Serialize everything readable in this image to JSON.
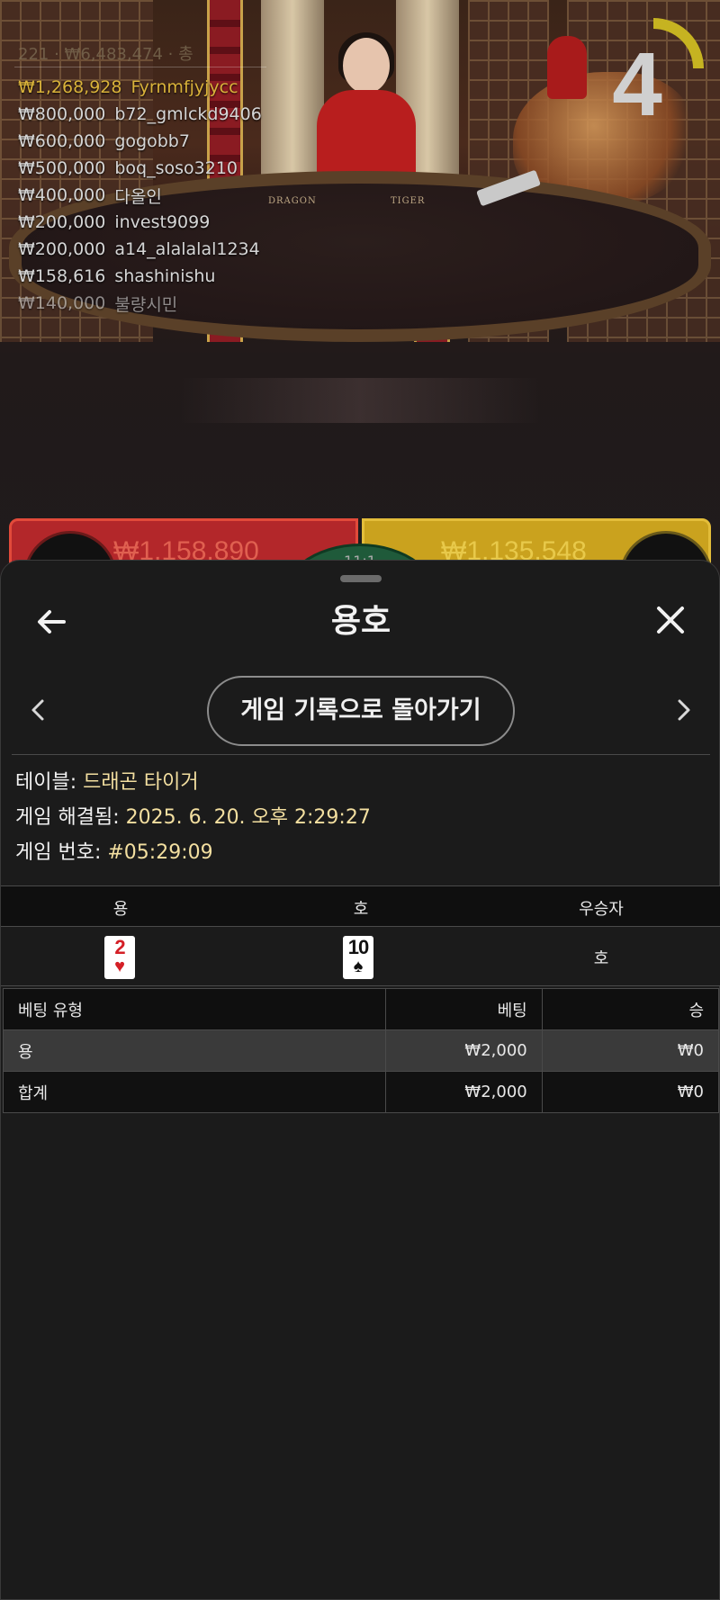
{
  "video": {
    "stats": "221 · ₩6,483,474 · 총",
    "table_labels": {
      "dragon": "DRAGON",
      "tiger": "TIGER"
    },
    "timer": "4",
    "leaderboard": [
      {
        "amount": "₩1,268,928",
        "name": "Fyrnmfjyjycc"
      },
      {
        "amount": "₩800,000",
        "name": "b72_gmlckd9406"
      },
      {
        "amount": "₩600,000",
        "name": "gogobb7"
      },
      {
        "amount": "₩500,000",
        "name": "boq_soso3210"
      },
      {
        "amount": "₩400,000",
        "name": "다올인"
      },
      {
        "amount": "₩200,000",
        "name": "invest9099"
      },
      {
        "amount": "₩200,000",
        "name": "a14_alalalal1234"
      },
      {
        "amount": "₩158,616",
        "name": "shashinishu"
      },
      {
        "amount": "₩140,000",
        "name": "불량시민"
      }
    ],
    "bets": {
      "dragon_total": "₩1,158,890",
      "tiger_total": "₩1,135,548",
      "tie_label": "11:1"
    }
  },
  "sheet": {
    "title": "용호",
    "back_to_history": "게임 기록으로 돌아가기",
    "info": {
      "table_label": "테이블:",
      "table_value": "드래곤 타이거",
      "resolved_label": "게임 해결됨:",
      "resolved_value": "2025. 6. 20. 오후 2:29:27",
      "number_label": "게임 번호:",
      "number_value": "#05:29:09"
    },
    "result": {
      "headers": [
        "용",
        "호",
        "우승자"
      ],
      "dragon_card": {
        "rank": "2",
        "suit": "♥"
      },
      "tiger_card": {
        "rank": "10",
        "suit": "♠"
      },
      "winner": "호"
    },
    "bets_table": {
      "headers": [
        "베팅 유형",
        "베팅",
        "승"
      ],
      "rows": [
        {
          "type": "용",
          "bet": "₩2,000",
          "win": "₩0"
        },
        {
          "type": "합계",
          "bet": "₩2,000",
          "win": "₩0"
        }
      ]
    }
  },
  "colors": {
    "sheet_bg": "#1b1b1b",
    "highlight_gold": "#f3dfa0",
    "dragon_red": "#b3272a",
    "tiger_gold": "#caa21e",
    "timer_ring": "#c6b321"
  },
  "icons": {
    "back": "arrow-left-icon",
    "close": "close-icon",
    "prev": "chevron-left-icon",
    "next": "chevron-right-icon"
  }
}
